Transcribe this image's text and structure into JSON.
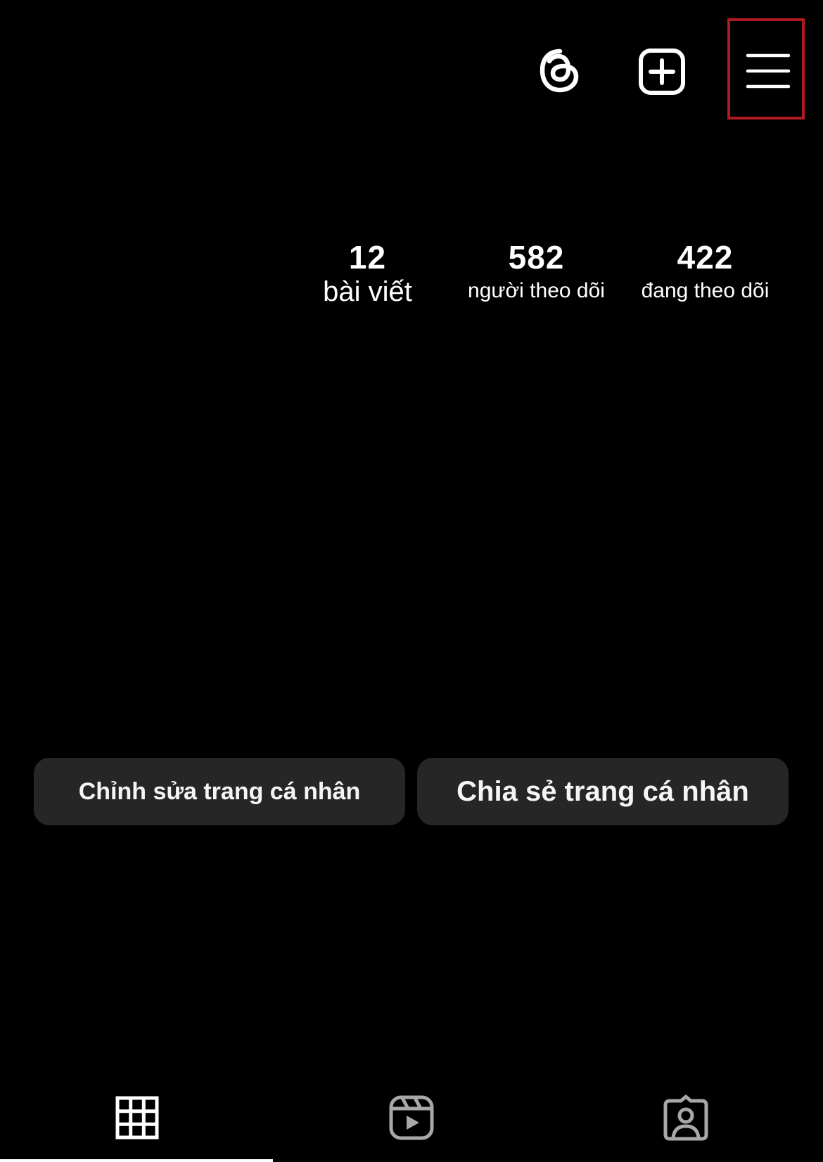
{
  "header": {
    "threads_icon": "threads-icon",
    "create_icon": "plus-square-icon",
    "menu_icon": "hamburger-menu-icon",
    "highlight_color": "#b0191e"
  },
  "stats": {
    "posts": {
      "count": "12",
      "label": "bài viết"
    },
    "followers": {
      "count": "582",
      "label": "người theo dõi"
    },
    "following": {
      "count": "422",
      "label": "đang theo dõi"
    }
  },
  "actions": {
    "edit_profile_label": "Chỉnh sửa trang cá nhân",
    "share_profile_label": "Chia sẻ trang cá nhân",
    "button_color": "#262626"
  },
  "tabs": [
    {
      "name": "posts-grid",
      "icon": "grid-icon",
      "active": true
    },
    {
      "name": "reels",
      "icon": "reels-icon",
      "active": false
    },
    {
      "name": "tagged",
      "icon": "tagged-person-icon",
      "active": false
    }
  ],
  "colors": {
    "background": "#000000",
    "text": "#ffffff",
    "inactive_icon": "#a8a8a8"
  }
}
